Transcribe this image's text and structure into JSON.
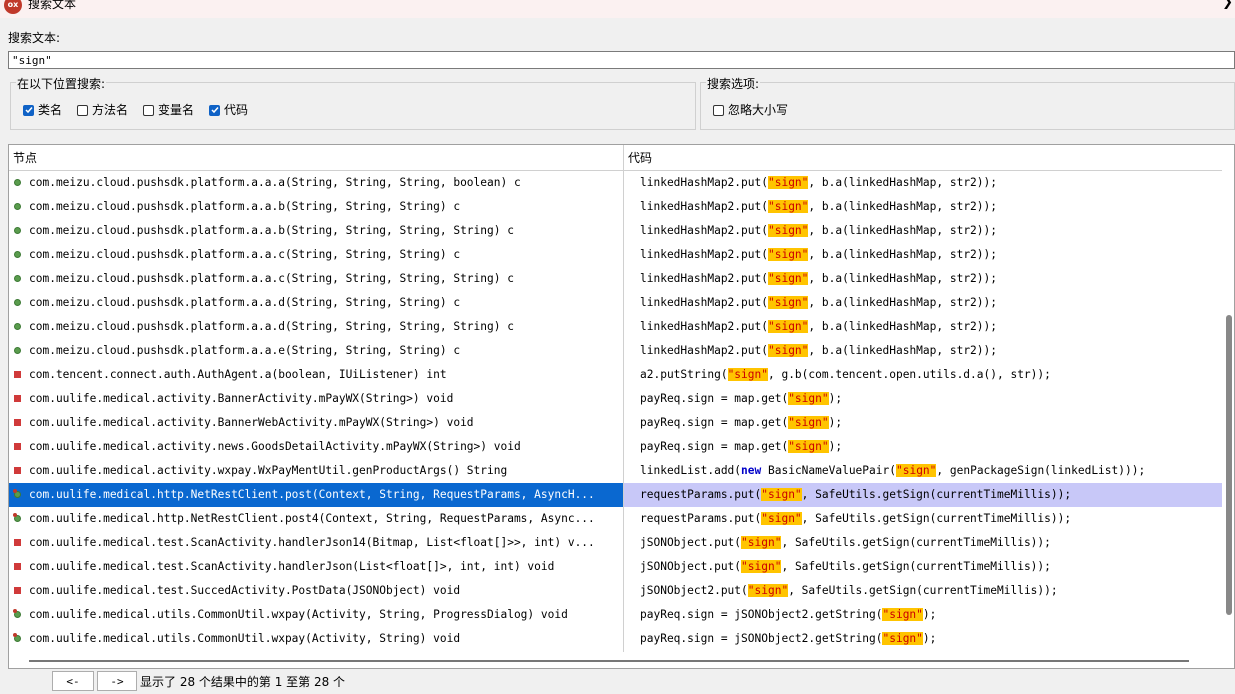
{
  "window": {
    "title": "搜索文本",
    "icon_label": "ox"
  },
  "search": {
    "label": "搜索文本:",
    "value": "\"sign\""
  },
  "location_group": {
    "title": "在以下位置搜索:",
    "options": [
      {
        "label": "类名",
        "checked": true
      },
      {
        "label": "方法名",
        "checked": false
      },
      {
        "label": "变量名",
        "checked": false
      },
      {
        "label": "代码",
        "checked": true
      }
    ]
  },
  "options_group": {
    "title": "搜索选项:",
    "options": [
      {
        "label": "忽略大小写",
        "checked": false
      }
    ]
  },
  "table": {
    "headers": {
      "node": "节点",
      "code": "代码"
    },
    "rows": [
      {
        "icon": "method",
        "node": "com.meizu.cloud.pushsdk.platform.a.a.a(String, String, String, boolean) c",
        "code": [
          [
            "linkedHashMap2.put(",
            ""
          ],
          [
            "\"sign\"",
            "hl"
          ],
          [
            ", b.a(linkedHashMap, str2));",
            ""
          ]
        ]
      },
      {
        "icon": "method",
        "node": "com.meizu.cloud.pushsdk.platform.a.a.b(String, String, String) c",
        "code": [
          [
            "linkedHashMap2.put(",
            ""
          ],
          [
            "\"sign\"",
            "hl"
          ],
          [
            ", b.a(linkedHashMap, str2));",
            ""
          ]
        ]
      },
      {
        "icon": "method",
        "node": "com.meizu.cloud.pushsdk.platform.a.a.b(String, String, String, String) c",
        "code": [
          [
            "linkedHashMap2.put(",
            ""
          ],
          [
            "\"sign\"",
            "hl"
          ],
          [
            ", b.a(linkedHashMap, str2));",
            ""
          ]
        ]
      },
      {
        "icon": "method",
        "node": "com.meizu.cloud.pushsdk.platform.a.a.c(String, String, String) c",
        "code": [
          [
            "linkedHashMap2.put(",
            ""
          ],
          [
            "\"sign\"",
            "hl"
          ],
          [
            ", b.a(linkedHashMap, str2));",
            ""
          ]
        ]
      },
      {
        "icon": "method",
        "node": "com.meizu.cloud.pushsdk.platform.a.a.c(String, String, String, String) c",
        "code": [
          [
            "linkedHashMap2.put(",
            ""
          ],
          [
            "\"sign\"",
            "hl"
          ],
          [
            ", b.a(linkedHashMap, str2));",
            ""
          ]
        ]
      },
      {
        "icon": "method",
        "node": "com.meizu.cloud.pushsdk.platform.a.a.d(String, String, String) c",
        "code": [
          [
            "linkedHashMap2.put(",
            ""
          ],
          [
            "\"sign\"",
            "hl"
          ],
          [
            ", b.a(linkedHashMap, str2));",
            ""
          ]
        ]
      },
      {
        "icon": "method",
        "node": "com.meizu.cloud.pushsdk.platform.a.a.d(String, String, String, String) c",
        "code": [
          [
            "linkedHashMap2.put(",
            ""
          ],
          [
            "\"sign\"",
            "hl"
          ],
          [
            ", b.a(linkedHashMap, str2));",
            ""
          ]
        ]
      },
      {
        "icon": "method",
        "node": "com.meizu.cloud.pushsdk.platform.a.a.e(String, String, String) c",
        "code": [
          [
            "linkedHashMap2.put(",
            ""
          ],
          [
            "\"sign\"",
            "hl"
          ],
          [
            ", b.a(linkedHashMap, str2));",
            ""
          ]
        ]
      },
      {
        "icon": "field",
        "node": "com.tencent.connect.auth.AuthAgent.a(boolean, IUiListener) int",
        "code": [
          [
            "a2.putString(",
            ""
          ],
          [
            "\"sign\"",
            "hl"
          ],
          [
            ", g.b(com.tencent.open.utils.d.a(), str));",
            ""
          ]
        ]
      },
      {
        "icon": "field",
        "node": "com.uulife.medical.activity.BannerActivity.mPayWX(String>) void",
        "code": [
          [
            "payReq.sign = map.get(",
            ""
          ],
          [
            "\"sign\"",
            "hl"
          ],
          [
            ");",
            ""
          ]
        ]
      },
      {
        "icon": "field",
        "node": "com.uulife.medical.activity.BannerWebActivity.mPayWX(String>) void",
        "code": [
          [
            "payReq.sign = map.get(",
            ""
          ],
          [
            "\"sign\"",
            "hl"
          ],
          [
            ");",
            ""
          ]
        ]
      },
      {
        "icon": "field",
        "node": "com.uulife.medical.activity.news.GoodsDetailActivity.mPayWX(String>) void",
        "code": [
          [
            "payReq.sign = map.get(",
            ""
          ],
          [
            "\"sign\"",
            "hl"
          ],
          [
            ");",
            ""
          ]
        ]
      },
      {
        "icon": "field",
        "node": "com.uulife.medical.activity.wxpay.WxPayMentUtil.genProductArgs() String",
        "code": [
          [
            "linkedList.add(",
            ""
          ],
          [
            "new",
            "kw"
          ],
          [
            " BasicNameValuePair(",
            ""
          ],
          [
            "\"sign\"",
            "hl"
          ],
          [
            ", genPackageSign(linkedList)));",
            ""
          ]
        ]
      },
      {
        "icon": "special",
        "node": "com.uulife.medical.http.NetRestClient.post(Context, String, RequestParams, AsyncH...",
        "code": [
          [
            "requestParams.put(",
            ""
          ],
          [
            "\"sign\"",
            "hl"
          ],
          [
            ", SafeUtils.getSign(currentTimeMillis));",
            ""
          ]
        ],
        "selected": true
      },
      {
        "icon": "special",
        "node": "com.uulife.medical.http.NetRestClient.post4(Context, String, RequestParams, Async...",
        "code": [
          [
            "requestParams.put(",
            ""
          ],
          [
            "\"sign\"",
            "hl"
          ],
          [
            ", SafeUtils.getSign(currentTimeMillis));",
            ""
          ]
        ]
      },
      {
        "icon": "field",
        "node": "com.uulife.medical.test.ScanActivity.handlerJson14(Bitmap, List<float[]>>, int) v...",
        "code": [
          [
            "jSONObject.put(",
            ""
          ],
          [
            "\"sign\"",
            "hl"
          ],
          [
            ", SafeUtils.getSign(currentTimeMillis));",
            ""
          ]
        ]
      },
      {
        "icon": "field",
        "node": "com.uulife.medical.test.ScanActivity.handlerJson(List<float[]>, int, int) void",
        "code": [
          [
            "jSONObject.put(",
            ""
          ],
          [
            "\"sign\"",
            "hl"
          ],
          [
            ", SafeUtils.getSign(currentTimeMillis));",
            ""
          ]
        ]
      },
      {
        "icon": "field",
        "node": "com.uulife.medical.test.SuccedActivity.PostData(JSONObject) void",
        "code": [
          [
            "jSONObject2.put(",
            ""
          ],
          [
            "\"sign\"",
            "hl"
          ],
          [
            ", SafeUtils.getSign(currentTimeMillis));",
            ""
          ]
        ]
      },
      {
        "icon": "special",
        "node": "com.uulife.medical.utils.CommonUtil.wxpay(Activity, String, ProgressDialog) void",
        "code": [
          [
            "payReq.sign = jSONObject2.getString(",
            ""
          ],
          [
            "\"sign\"",
            "hl"
          ],
          [
            ");",
            ""
          ]
        ]
      },
      {
        "icon": "special",
        "node": "com.uulife.medical.utils.CommonUtil.wxpay(Activity, String) void",
        "code": [
          [
            "payReq.sign = jSONObject2.getString(",
            ""
          ],
          [
            "\"sign\"",
            "hl"
          ],
          [
            ");",
            ""
          ]
        ]
      }
    ]
  },
  "footer": {
    "prev_label": "<-",
    "next_label": "->",
    "status": "显示了 28 个结果中的第 1 至第 28 个"
  },
  "colors": {
    "selection": "#0a68d0",
    "code_selection": "#c8c8f8",
    "highlight": "#ffc400",
    "checkbox": "#0f62c6"
  }
}
